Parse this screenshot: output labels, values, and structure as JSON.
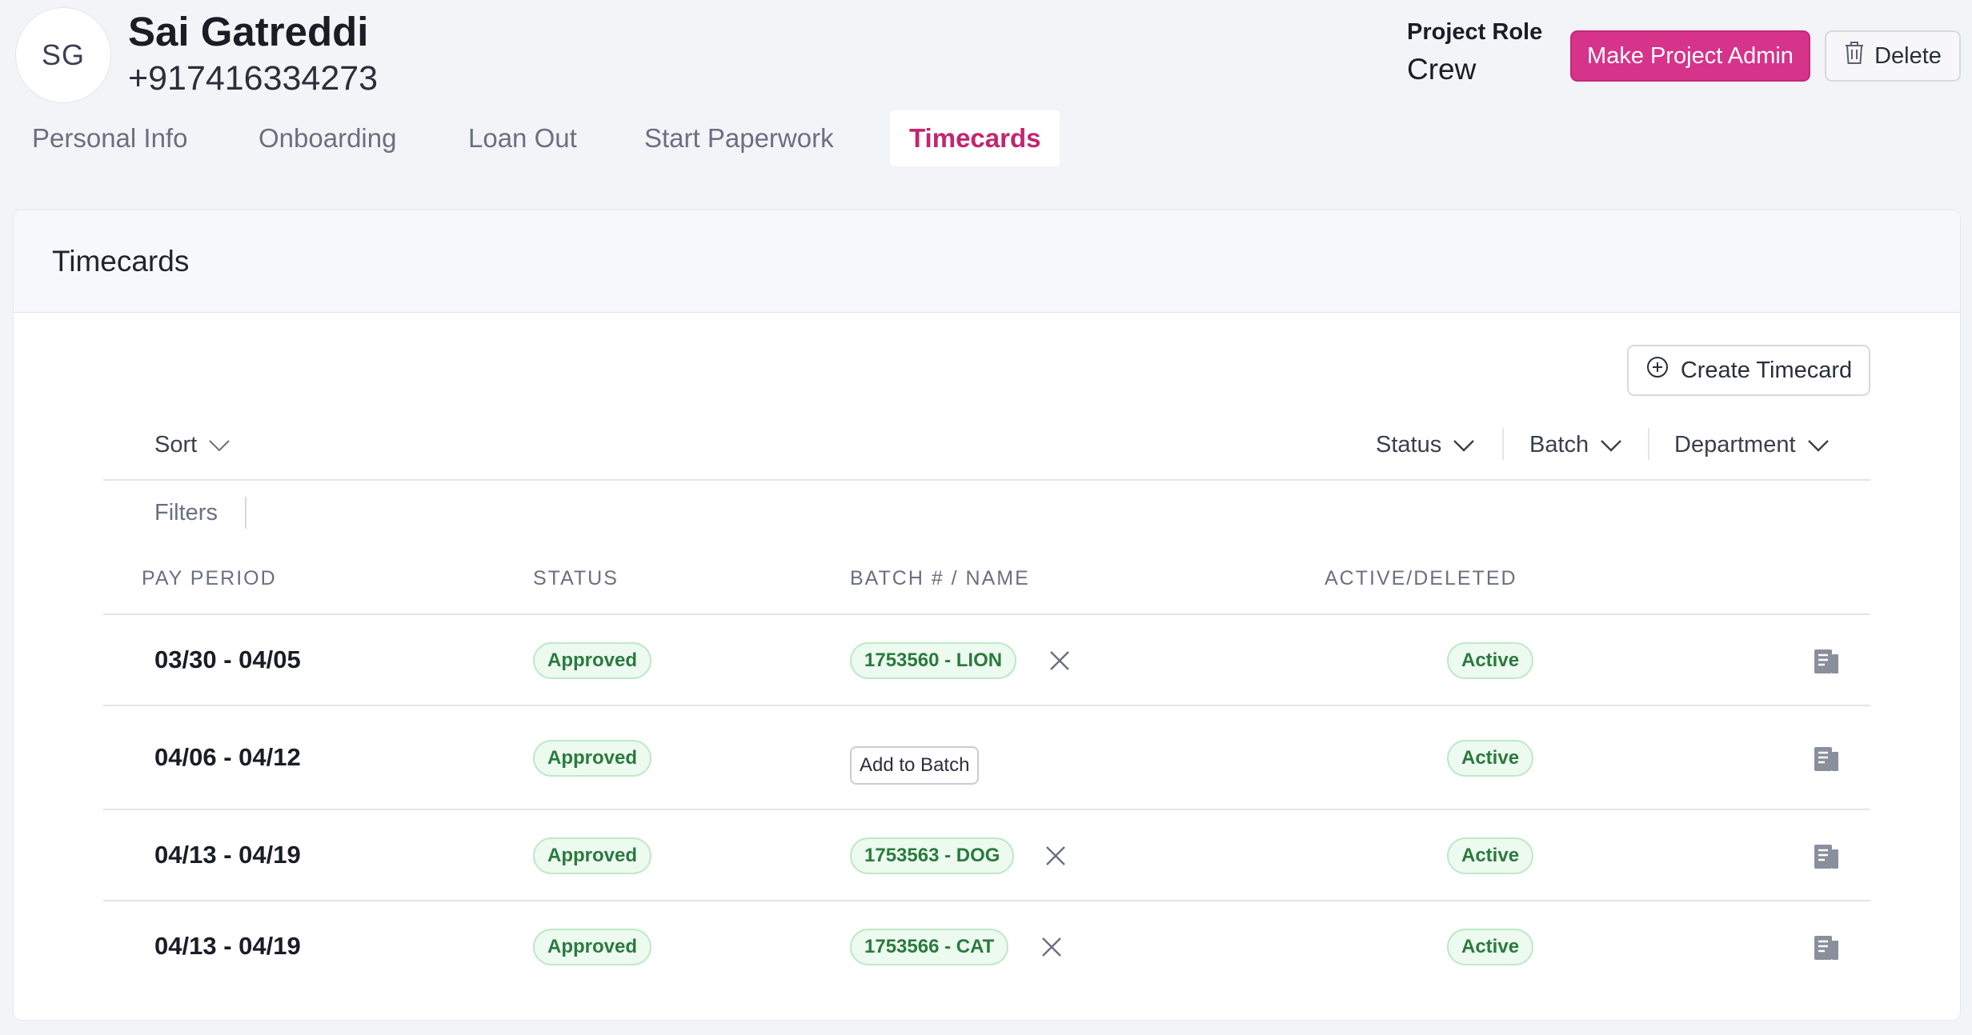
{
  "user": {
    "initials": "SG",
    "name": "Sai Gatreddi",
    "phone": "+917416334273"
  },
  "project_role": {
    "label": "Project Role",
    "value": "Crew"
  },
  "actions": {
    "make_admin": "Make Project Admin",
    "delete": "Delete"
  },
  "tabs": [
    {
      "label": "Personal Info",
      "active": false
    },
    {
      "label": "Onboarding",
      "active": false
    },
    {
      "label": "Loan Out",
      "active": false
    },
    {
      "label": "Start Paperwork",
      "active": false
    },
    {
      "label": "Timecards",
      "active": true
    }
  ],
  "card": {
    "title": "Timecards",
    "create_button": "Create Timecard"
  },
  "toolbar": {
    "sort": "Sort",
    "status": "Status",
    "batch": "Batch",
    "department": "Department",
    "filters": "Filters"
  },
  "table": {
    "columns": [
      "PAY PERIOD",
      "STATUS",
      "BATCH # / NAME",
      "ACTIVE/DELETED"
    ],
    "add_to_batch_label": "Add to Batch",
    "rows": [
      {
        "pay_period": "03/30 - 04/05",
        "status": "Approved",
        "batch": "1753560 - LION",
        "state": "Active"
      },
      {
        "pay_period": "04/06 - 04/12",
        "status": "Approved",
        "batch": null,
        "state": "Active"
      },
      {
        "pay_period": "04/13 - 04/19",
        "status": "Approved",
        "batch": "1753563 - DOG",
        "state": "Active"
      },
      {
        "pay_period": "04/13 - 04/19",
        "status": "Approved",
        "batch": "1753566 - CAT",
        "state": "Active"
      }
    ]
  },
  "colors": {
    "accent": "#d6338a",
    "active_tab": "#c4246e",
    "badge_bg": "#ecfaef",
    "badge_text": "#2b7a3e"
  },
  "icons": {
    "delete": "trash-icon",
    "create": "plus-circle-icon",
    "dropdown": "chevron-down-icon",
    "remove": "close-icon",
    "row_action": "document-icon"
  }
}
